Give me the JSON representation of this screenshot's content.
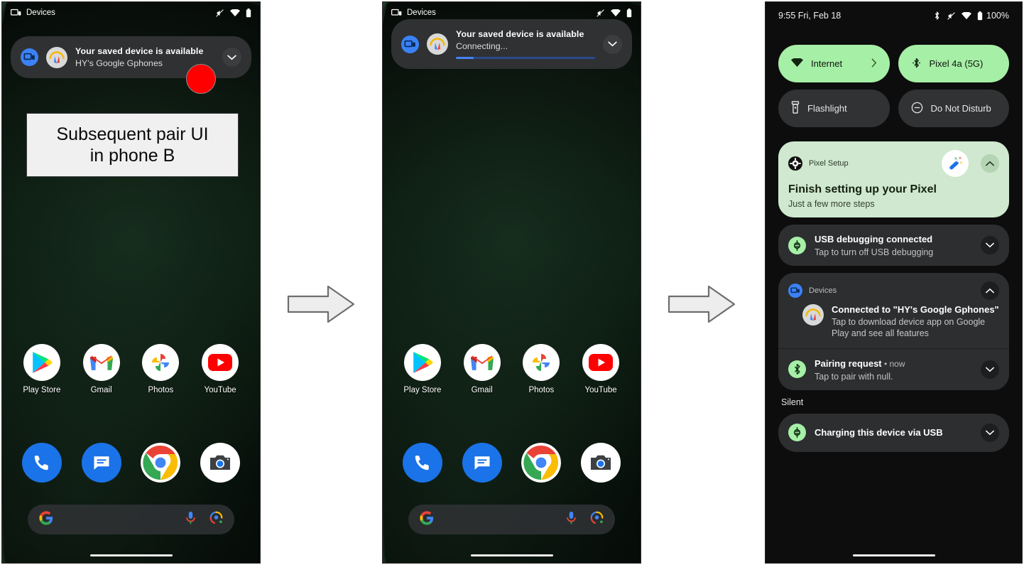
{
  "phone_a": {
    "statusbar": {
      "app_label": "Devices",
      "icons": [
        "mute-icon",
        "wifi-icon",
        "battery-icon"
      ]
    },
    "notification": {
      "title": "Your saved device is available",
      "subtitle": "HY's Google Gphones",
      "app_icon": "devices-icon",
      "avatar": "headphones-icon",
      "chevron": "chevron-down-icon"
    },
    "caption": "Subsequent pair UI\nin phone B",
    "marker_color": "#ff0000",
    "apps": [
      {
        "label": "Play Store",
        "icon": "play-store-icon"
      },
      {
        "label": "Gmail",
        "icon": "gmail-icon"
      },
      {
        "label": "Photos",
        "icon": "google-photos-icon"
      },
      {
        "label": "YouTube",
        "icon": "youtube-icon"
      }
    ],
    "dock": [
      {
        "label": "Phone",
        "icon": "phone-icon"
      },
      {
        "label": "Messages",
        "icon": "messages-icon"
      },
      {
        "label": "Chrome",
        "icon": "chrome-icon"
      },
      {
        "label": "Camera",
        "icon": "camera-icon"
      }
    ],
    "search": {
      "logo": "google-g-icon",
      "mic": "microphone-icon",
      "lens": "google-lens-icon"
    }
  },
  "phone_b": {
    "statusbar": {
      "app_label": "Devices",
      "icons": [
        "mute-icon",
        "wifi-icon",
        "battery-icon"
      ]
    },
    "notification": {
      "title": "Your saved device is available",
      "subtitle": "Connecting...",
      "app_icon": "devices-icon",
      "avatar": "headphones-icon",
      "chevron": "chevron-down-icon",
      "progress_percent": 13
    },
    "apps": [
      {
        "label": "Play Store",
        "icon": "play-store-icon"
      },
      {
        "label": "Gmail",
        "icon": "gmail-icon"
      },
      {
        "label": "Photos",
        "icon": "google-photos-icon"
      },
      {
        "label": "YouTube",
        "icon": "youtube-icon"
      }
    ],
    "dock": [
      {
        "label": "Phone",
        "icon": "phone-icon"
      },
      {
        "label": "Messages",
        "icon": "messages-icon"
      },
      {
        "label": "Chrome",
        "icon": "chrome-icon"
      },
      {
        "label": "Camera",
        "icon": "camera-icon"
      }
    ],
    "search": {
      "logo": "google-g-icon",
      "mic": "microphone-icon",
      "lens": "google-lens-icon"
    }
  },
  "phone_c": {
    "statusbar": {
      "clock": "9:55 Fri, Feb 18",
      "battery_percent": "100%",
      "icons": [
        "bluetooth-icon",
        "mute-icon",
        "wifi-icon",
        "battery-icon"
      ]
    },
    "quick_settings": [
      {
        "label": "Internet",
        "icon": "wifi-icon",
        "state": "on",
        "trailing": "chevron-right-icon"
      },
      {
        "label": "Pixel 4a (5G)",
        "icon": "bluetooth-icon",
        "state": "on",
        "trailing": ""
      },
      {
        "label": "Flashlight",
        "icon": "flashlight-icon",
        "state": "off",
        "trailing": ""
      },
      {
        "label": "Do Not Disturb",
        "icon": "do-not-disturb-icon",
        "state": "off",
        "trailing": ""
      }
    ],
    "notifications": {
      "pixel_setup": {
        "app_name": "Pixel Setup",
        "app_icon": "gear-icon",
        "title": "Finish setting up your Pixel",
        "subtitle": "Just a few more steps",
        "thumb": "magic-wand-icon",
        "chevron": "chevron-up-icon"
      },
      "usb_debugging": {
        "title": "USB debugging connected",
        "subtitle": "Tap to turn off USB debugging",
        "icon": "android-usb-icon",
        "chevron": "chevron-down-icon"
      },
      "devices": {
        "app_name": "Devices",
        "app_icon": "devices-icon",
        "title": "Connected to \"HY's Google Gphones\"",
        "subtitle": "Tap to download device app on Google Play and see all features",
        "avatar": "headphones-icon",
        "chevron": "chevron-up-icon"
      },
      "pairing_request": {
        "title": "Pairing request",
        "time": " • now",
        "subtitle": "Tap to pair with null.",
        "icon": "bluetooth-icon",
        "chevron": "chevron-down-icon"
      },
      "silent_header": "Silent",
      "charging": {
        "title": "Charging this device via USB",
        "icon": "android-usb-icon",
        "chevron": "chevron-down-icon"
      }
    }
  },
  "flow": {
    "arrow_1": "right-arrow-icon",
    "arrow_2": "right-arrow-icon"
  },
  "colors": {
    "accent_green": "#a6efa6",
    "notif_surface": "#2c2e30",
    "shade_bg": "#0d0d0d",
    "marker_red": "#ff0000",
    "progress_blue": "#4285f4"
  }
}
